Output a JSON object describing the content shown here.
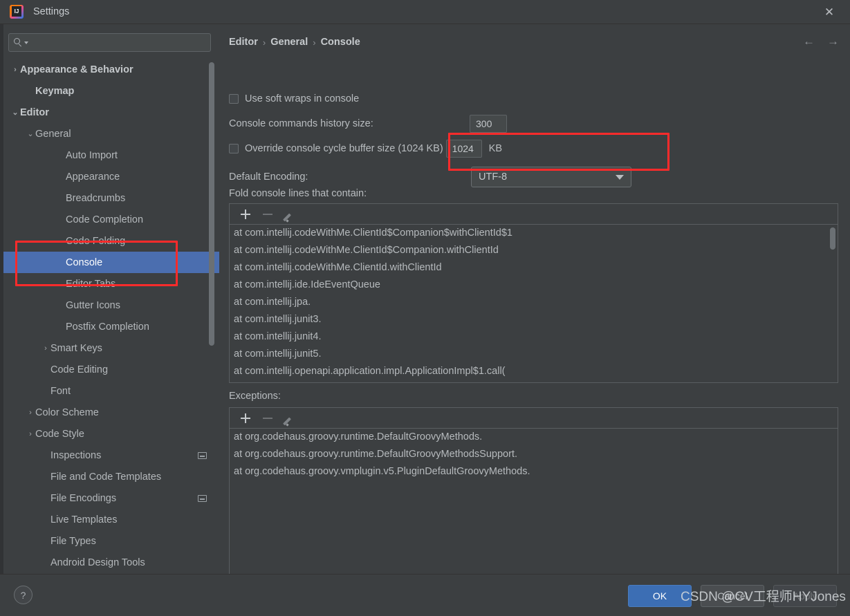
{
  "window": {
    "title": "Settings",
    "app_icon": "intellij-idea-icon",
    "close_label": "✕"
  },
  "search": {
    "value": "",
    "placeholder": "",
    "icon": "search-icon"
  },
  "sidebar": {
    "items": [
      {
        "label": "Appearance & Behavior",
        "indent": 0,
        "arrow": "›",
        "bold": true,
        "selected": false,
        "badge": false
      },
      {
        "label": "Keymap",
        "indent": 1,
        "arrow": "",
        "bold": true,
        "selected": false,
        "badge": false
      },
      {
        "label": "Editor",
        "indent": 0,
        "arrow": "⌄",
        "bold": true,
        "selected": false,
        "badge": false
      },
      {
        "label": "General",
        "indent": 1,
        "arrow": "⌄",
        "bold": false,
        "selected": false,
        "badge": false
      },
      {
        "label": "Auto Import",
        "indent": 3,
        "arrow": "",
        "bold": false,
        "selected": false,
        "badge": false
      },
      {
        "label": "Appearance",
        "indent": 3,
        "arrow": "",
        "bold": false,
        "selected": false,
        "badge": false
      },
      {
        "label": "Breadcrumbs",
        "indent": 3,
        "arrow": "",
        "bold": false,
        "selected": false,
        "badge": false
      },
      {
        "label": "Code Completion",
        "indent": 3,
        "arrow": "",
        "bold": false,
        "selected": false,
        "badge": false
      },
      {
        "label": "Code Folding",
        "indent": 3,
        "arrow": "",
        "bold": false,
        "selected": false,
        "badge": false
      },
      {
        "label": "Console",
        "indent": 3,
        "arrow": "",
        "bold": false,
        "selected": true,
        "badge": false
      },
      {
        "label": "Editor Tabs",
        "indent": 3,
        "arrow": "",
        "bold": false,
        "selected": false,
        "badge": false
      },
      {
        "label": "Gutter Icons",
        "indent": 3,
        "arrow": "",
        "bold": false,
        "selected": false,
        "badge": false
      },
      {
        "label": "Postfix Completion",
        "indent": 3,
        "arrow": "",
        "bold": false,
        "selected": false,
        "badge": false
      },
      {
        "label": "Smart Keys",
        "indent": 2,
        "arrow": "›",
        "bold": false,
        "selected": false,
        "badge": false
      },
      {
        "label": "Code Editing",
        "indent": 2,
        "arrow": "",
        "bold": false,
        "selected": false,
        "badge": false
      },
      {
        "label": "Font",
        "indent": 2,
        "arrow": "",
        "bold": false,
        "selected": false,
        "badge": false
      },
      {
        "label": "Color Scheme",
        "indent": 1,
        "arrow": "›",
        "bold": false,
        "selected": false,
        "badge": false
      },
      {
        "label": "Code Style",
        "indent": 1,
        "arrow": "›",
        "bold": false,
        "selected": false,
        "badge": false
      },
      {
        "label": "Inspections",
        "indent": 2,
        "arrow": "",
        "bold": false,
        "selected": false,
        "badge": true
      },
      {
        "label": "File and Code Templates",
        "indent": 2,
        "arrow": "",
        "bold": false,
        "selected": false,
        "badge": false
      },
      {
        "label": "File Encodings",
        "indent": 2,
        "arrow": "",
        "bold": false,
        "selected": false,
        "badge": true
      },
      {
        "label": "Live Templates",
        "indent": 2,
        "arrow": "",
        "bold": false,
        "selected": false,
        "badge": false
      },
      {
        "label": "File Types",
        "indent": 2,
        "arrow": "",
        "bold": false,
        "selected": false,
        "badge": false
      },
      {
        "label": "Android Design Tools",
        "indent": 2,
        "arrow": "",
        "bold": false,
        "selected": false,
        "badge": false
      }
    ]
  },
  "breadcrumb": {
    "items": [
      "Editor",
      "General",
      "Console"
    ],
    "separator": "›"
  },
  "nav": {
    "back": "←",
    "forward": "→"
  },
  "settings": {
    "soft_wraps_label": "Use soft wraps in console",
    "soft_wraps_checked": false,
    "history_label": "Console commands history size:",
    "history_value": "300",
    "override_label": "Override console cycle buffer size (1024 KB)",
    "override_checked": false,
    "override_value": "1024",
    "override_unit": "KB",
    "encoding_label": "Default Encoding:",
    "encoding_value": "UTF-8",
    "fold_label": "Fold console lines that contain:",
    "exceptions_label": "Exceptions:"
  },
  "fold_list": {
    "toolbar": {
      "add": "add-icon",
      "remove": "remove-icon",
      "edit": "edit-icon"
    },
    "items": [
      "at com.intellij.codeWithMe.ClientId$Companion$withClientId$1",
      "at com.intellij.codeWithMe.ClientId$Companion.withClientId",
      "at com.intellij.codeWithMe.ClientId.withClientId",
      "at com.intellij.ide.IdeEventQueue",
      "at com.intellij.jpa.",
      "at com.intellij.junit3.",
      "at com.intellij.junit4.",
      "at com.intellij.junit5.",
      "at com.intellij.openapi.application.impl.ApplicationImpl$1.call("
    ]
  },
  "exceptions_list": {
    "toolbar": {
      "add": "add-icon",
      "remove": "remove-icon",
      "edit": "edit-icon"
    },
    "items": [
      "at org.codehaus.groovy.runtime.DefaultGroovyMethods.",
      "at org.codehaus.groovy.runtime.DefaultGroovyMethodsSupport.",
      "at org.codehaus.groovy.vmplugin.v5.PluginDefaultGroovyMethods."
    ]
  },
  "footer": {
    "help_label": "?",
    "ok_label": "OK",
    "cancel_label": "Cancel",
    "apply_label": "Apply"
  },
  "watermark": {
    "text": "CSDN @CV工程师HYJones"
  },
  "colors": {
    "accent_selection": "#4b6eaf",
    "ok_button": "#3c6eb4",
    "annotation_red": "#ff2b2b",
    "background": "#3c3f41"
  }
}
